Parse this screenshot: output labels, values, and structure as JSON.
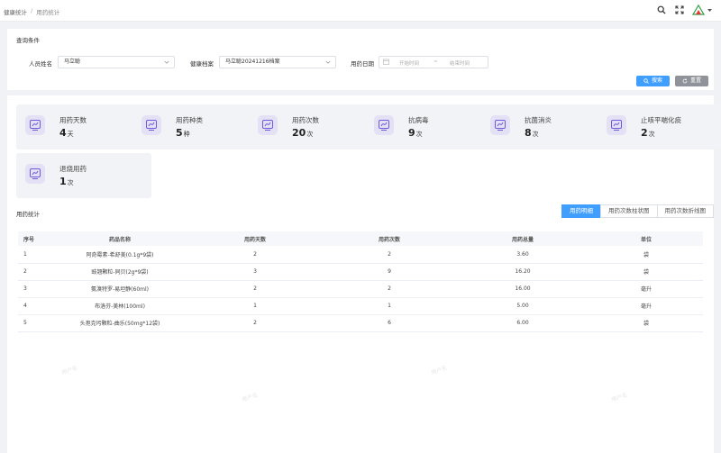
{
  "breadcrumb": {
    "parent": "健康统计",
    "current": "用药统计"
  },
  "top_icons": [
    "search-icon",
    "fullscreen-icon",
    "avatar"
  ],
  "search": {
    "title": "查询条件",
    "person_label": "人员姓名",
    "person_value": "马立聪",
    "record_label": "健康档案",
    "record_value": "马立聪20241216档案",
    "date_label": "用药日期",
    "start_placeholder": "开始时间",
    "end_placeholder": "结束时间",
    "date_separator": "~",
    "search_button": "搜索",
    "reset_button": "重置"
  },
  "stats": [
    {
      "label": "用药天数",
      "value": "4",
      "unit": "天"
    },
    {
      "label": "用药种类",
      "value": "5",
      "unit": "种"
    },
    {
      "label": "用药次数",
      "value": "20",
      "unit": "次"
    },
    {
      "label": "抗病毒",
      "value": "9",
      "unit": "次"
    },
    {
      "label": "抗菌消炎",
      "value": "8",
      "unit": "次"
    },
    {
      "label": "止咳平喘化痰",
      "value": "2",
      "unit": "次"
    },
    {
      "label": "退烧用药",
      "value": "1",
      "unit": "次"
    }
  ],
  "stats_section_title": "用药统计",
  "tabs": [
    "用药明细",
    "用药次数柱状图",
    "用药次数折线图"
  ],
  "active_tab": 0,
  "table": {
    "columns": [
      "序号",
      "药品名称",
      "用药天数",
      "用药次数",
      "用药总量",
      "单位"
    ],
    "rows": [
      [
        "1",
        "阿奇霉素-希舒美(0.1g*9袋)",
        "2",
        "2",
        "3.60",
        "袋"
      ],
      [
        "2",
        "豉翘颗粒-同贝(2g*9袋)",
        "3",
        "9",
        "16.20",
        "袋"
      ],
      [
        "3",
        "氨溴特罗-易坦静(60ml)",
        "2",
        "2",
        "16.00",
        "毫升"
      ],
      [
        "4",
        "布洛芬-美林(100ml)",
        "1",
        "1",
        "5.00",
        "毫升"
      ],
      [
        "5",
        "头孢克圬颗粒-曲乐(50mg*12袋)",
        "2",
        "6",
        "6.00",
        "袋"
      ]
    ]
  },
  "colors": {
    "primary": "#409eff",
    "gray_button": "#909399",
    "card_bg": "#f2f3f7",
    "icon_bg": "#e4e0f6",
    "icon_stroke": "#6e5bd8"
  }
}
